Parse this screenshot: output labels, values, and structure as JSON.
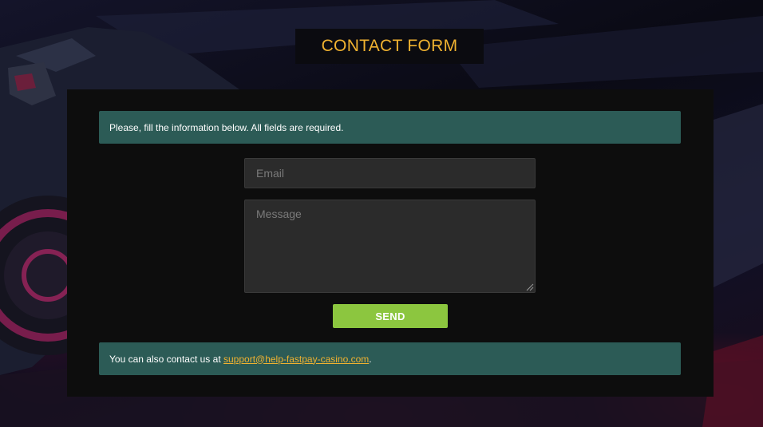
{
  "header": {
    "title": "CONTACT FORM"
  },
  "form": {
    "intro_notice": "Please, fill the information below. All fields are required.",
    "email_placeholder": "Email",
    "message_placeholder": "Message",
    "send_label": "SEND",
    "footer_prefix": "You can also contact us at ",
    "footer_email": "support@help-fastpay-casino.com",
    "footer_suffix": "."
  },
  "colors": {
    "accent": "#f0b230",
    "notice_bg": "#2c5b56",
    "send_button": "#8cc63f",
    "panel_bg": "#0d0d0d"
  },
  "icons": {
    "textarea_resize": "resize-grip-icon"
  }
}
